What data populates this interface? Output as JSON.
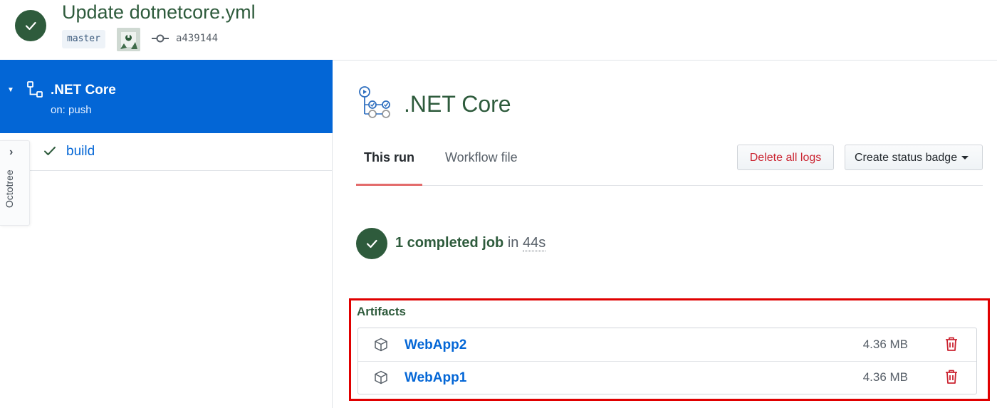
{
  "header": {
    "title": "Update dotnetcore.yml",
    "branch": "master",
    "commit_sha": "a439144"
  },
  "sidebar": {
    "workflow": {
      "name": ".NET Core",
      "trigger": "on: push"
    },
    "jobs": [
      {
        "name": "build",
        "status": "success"
      }
    ],
    "octotree_label": "Octotree"
  },
  "main": {
    "title": ".NET Core",
    "tabs": [
      {
        "label": "This run",
        "active": true
      },
      {
        "label": "Workflow file",
        "active": false
      }
    ],
    "buttons": {
      "delete_logs": "Delete all logs",
      "status_badge": "Create status badge"
    },
    "summary": {
      "count_text": "1 completed job",
      "in_word": "in",
      "duration": "44s"
    }
  },
  "artifacts": {
    "title": "Artifacts",
    "items": [
      {
        "name": "WebApp2",
        "size": "4.36 MB"
      },
      {
        "name": "WebApp1",
        "size": "4.36 MB"
      }
    ]
  },
  "colors": {
    "success_green": "#2e5b3c",
    "link_blue": "#0366d6",
    "selected_bg": "#0366d6",
    "danger_red": "#cb2431",
    "highlight_border": "#e00000"
  }
}
